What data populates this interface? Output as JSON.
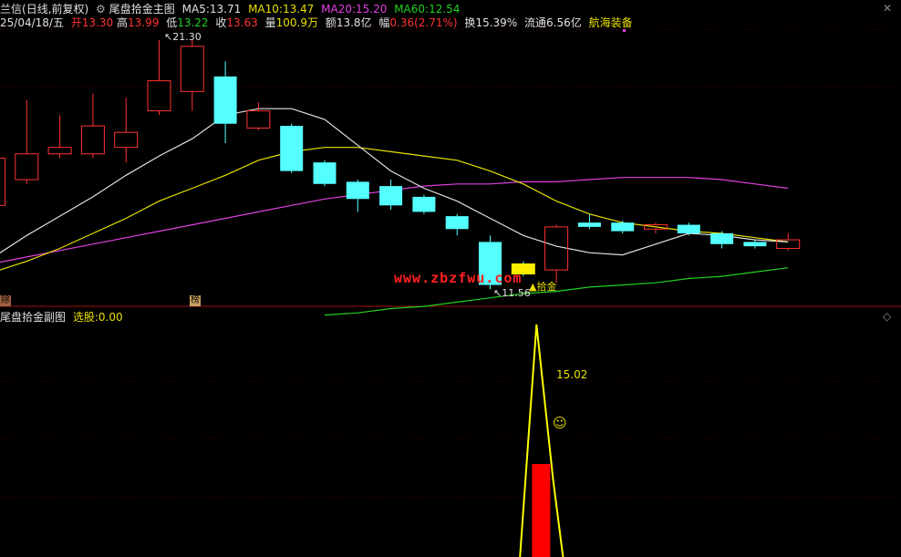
{
  "header": {
    "app": "兰信",
    "mode": "(日线,前复权)",
    "indicator_icon": "gear-icon",
    "indicator_name": "尾盘拾金主图",
    "ma5_label": "MA5:",
    "ma5_value": "13.71",
    "ma10_label": "MA10:",
    "ma10_value": "13.47",
    "ma20_label": "MA20:",
    "ma20_value": "15.20",
    "ma60_label": "MA60:",
    "ma60_value": "12.54",
    "date": "25/04/18/五",
    "open_label": "开",
    "open_value": "13.30",
    "high_label": "高",
    "high_value": "13.99",
    "low_label": "低",
    "low_value": "13.22",
    "close_label": "收",
    "close_value": "13.63",
    "vol_label": "量",
    "vol_value": "100.9万",
    "amt_label": "额",
    "amt_value": "13.8亿",
    "chg_label": "幅",
    "chg_value": "0.36(2.71%)",
    "turn_label": "换",
    "turn_value": "15.39%",
    "float_label": "流通",
    "float_value": "6.56亿",
    "stock_name": "航海装备"
  },
  "sub_header": {
    "title": "尾盘拾金副图",
    "xg_label": "选股:",
    "xg_value": "0.00"
  },
  "annotations": {
    "high_price": "21.30",
    "low_price": "11.56",
    "signal_label": "拾金",
    "badge_left": "榜",
    "badge_edge": "除",
    "sub_value": "15.02",
    "smiley_icon": "smiley-icon",
    "watermark": "www.zbzfwu.com",
    "corner_close": "✕",
    "corner_diamond": "◇"
  },
  "colors": {
    "up": "#ff3232",
    "down": "#54ffff",
    "ma5": "#e0e0e0",
    "ma10": "#e8e000",
    "ma20": "#e040e0",
    "ma60": "#20d020",
    "signal_bar": "#ff0000",
    "signal_line": "#ffff00"
  },
  "chart_data": {
    "type": "candlestick",
    "title": "尾盘拾金主图",
    "ylim": [
      9.5,
      21.8
    ],
    "candles": [
      {
        "o": 13.6,
        "c": 15.8,
        "h": 16.2,
        "l": 13.4
      },
      {
        "o": 14.8,
        "c": 16.0,
        "h": 18.5,
        "l": 14.6
      },
      {
        "o": 16.0,
        "c": 16.3,
        "h": 17.8,
        "l": 15.8
      },
      {
        "o": 16.0,
        "c": 17.3,
        "h": 18.8,
        "l": 15.8
      },
      {
        "o": 16.3,
        "c": 17.0,
        "h": 18.6,
        "l": 15.6
      },
      {
        "o": 18.0,
        "c": 19.4,
        "h": 21.3,
        "l": 17.8
      },
      {
        "o": 18.9,
        "c": 21.0,
        "h": 21.3,
        "l": 18.0
      },
      {
        "o": 19.6,
        "c": 17.4,
        "h": 20.3,
        "l": 16.5
      },
      {
        "o": 17.2,
        "c": 18.0,
        "h": 18.4,
        "l": 17.1
      },
      {
        "o": 17.3,
        "c": 15.2,
        "h": 17.4,
        "l": 15.1
      },
      {
        "o": 15.6,
        "c": 14.6,
        "h": 15.7,
        "l": 14.5
      },
      {
        "o": 14.7,
        "c": 13.9,
        "h": 14.8,
        "l": 13.3
      },
      {
        "o": 14.5,
        "c": 13.6,
        "h": 14.8,
        "l": 13.4
      },
      {
        "o": 14.0,
        "c": 13.3,
        "h": 14.1,
        "l": 13.2
      },
      {
        "o": 13.1,
        "c": 12.5,
        "h": 13.2,
        "l": 12.2
      },
      {
        "o": 11.9,
        "c": 9.9,
        "h": 12.2,
        "l": 9.7
      },
      {
        "o": 10.9,
        "c": 10.5,
        "h": 11.0,
        "l": 10.3
      },
      {
        "o": 10.6,
        "c": 12.6,
        "h": 12.7,
        "l": 10.0
      },
      {
        "o": 12.8,
        "c": 12.6,
        "h": 13.2,
        "l": 12.5
      },
      {
        "o": 12.8,
        "c": 12.4,
        "h": 12.9,
        "l": 12.3
      },
      {
        "o": 12.5,
        "c": 12.7,
        "h": 12.8,
        "l": 12.3
      },
      {
        "o": 12.7,
        "c": 12.3,
        "h": 12.8,
        "l": 12.2
      },
      {
        "o": 12.3,
        "c": 11.8,
        "h": 12.4,
        "l": 11.6
      },
      {
        "o": 11.9,
        "c": 11.7,
        "h": 12.0,
        "l": 11.6
      },
      {
        "o": 11.6,
        "c": 12.0,
        "h": 12.3,
        "l": 11.5
      }
    ],
    "ma5": [
      11.2,
      12.2,
      13.1,
      14.0,
      15.0,
      15.9,
      16.7,
      17.8,
      18.1,
      18.1,
      17.6,
      16.4,
      15.2,
      14.4,
      13.8,
      13.0,
      12.2,
      11.7,
      11.4,
      11.3,
      11.8,
      12.3,
      12.2,
      12.0,
      11.9
    ],
    "ma10": [
      10.5,
      11.0,
      11.6,
      12.3,
      13.0,
      13.8,
      14.4,
      15.0,
      15.7,
      16.1,
      16.3,
      16.3,
      16.1,
      15.9,
      15.7,
      15.2,
      14.6,
      13.8,
      13.2,
      12.8,
      12.6,
      12.4,
      12.3,
      12.1,
      11.9
    ],
    "ma20": [
      10.9,
      11.2,
      11.5,
      11.8,
      12.1,
      12.4,
      12.7,
      13.0,
      13.3,
      13.6,
      13.9,
      14.1,
      14.3,
      14.5,
      14.6,
      14.6,
      14.7,
      14.7,
      14.8,
      14.9,
      14.9,
      14.9,
      14.8,
      14.6,
      14.4
    ],
    "ma60": [
      null,
      null,
      null,
      null,
      null,
      null,
      null,
      null,
      null,
      null,
      8.5,
      8.6,
      8.8,
      8.9,
      9.1,
      9.3,
      9.5,
      9.6,
      9.8,
      9.9,
      10.0,
      10.2,
      10.3,
      10.5,
      10.7
    ],
    "signal_index": 15,
    "sub_series": {
      "xg": [
        0,
        0,
        0,
        0,
        0,
        0,
        0,
        0,
        0,
        0,
        0,
        0,
        0,
        0,
        0,
        0,
        0,
        0,
        0,
        0,
        0,
        0,
        0,
        0,
        0
      ],
      "line_points": [
        [
          15,
          0
        ],
        [
          15.5,
          30
        ],
        [
          16,
          10
        ],
        [
          16.3,
          0
        ]
      ],
      "bar_value": 12,
      "ylim": [
        0,
        30
      ]
    }
  }
}
